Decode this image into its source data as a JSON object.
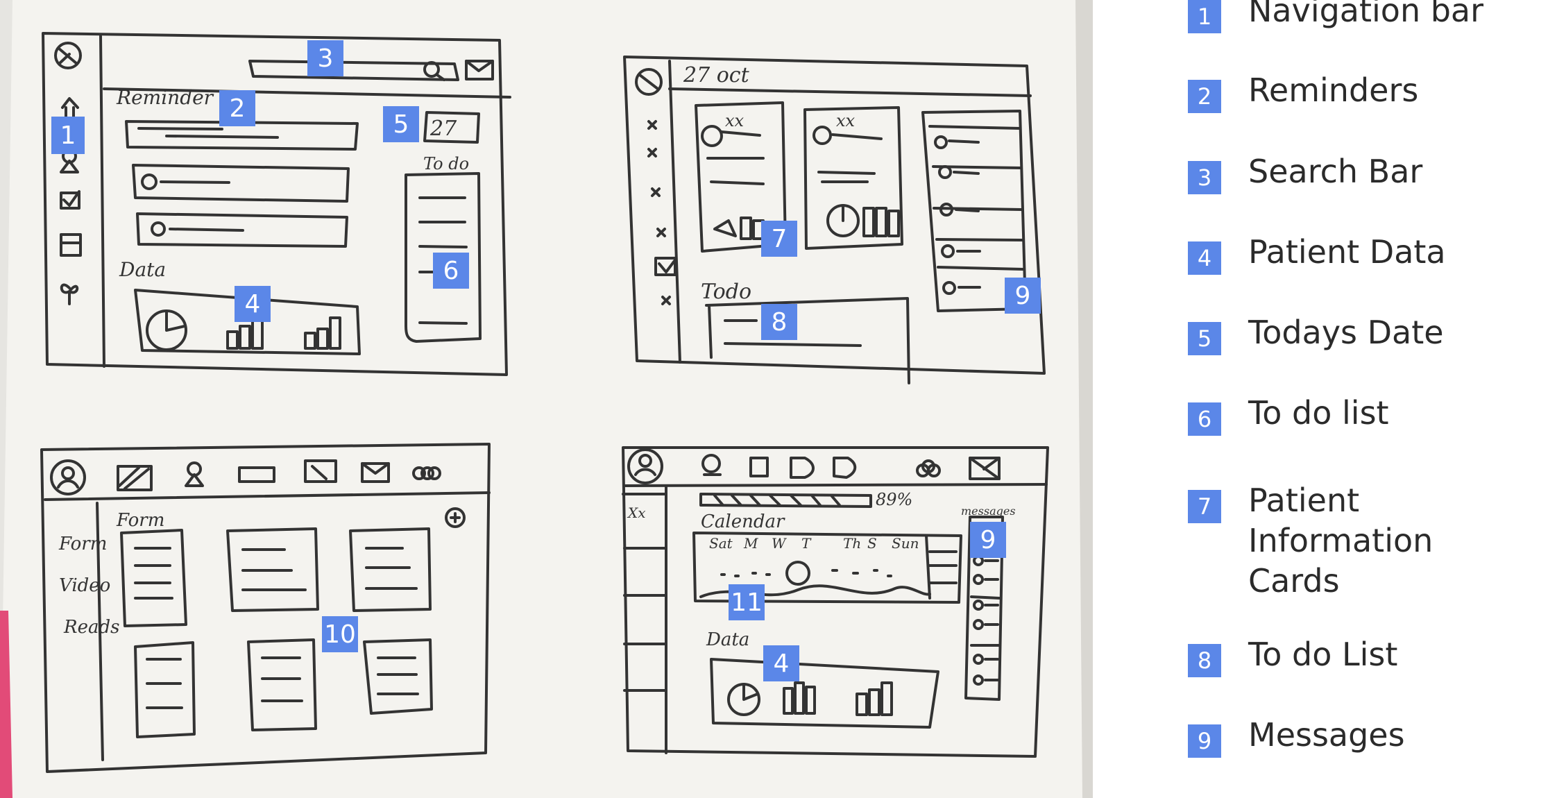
{
  "sketches": {
    "dashboard": {
      "reminder_label": "Reminder",
      "todo_label": "To do",
      "data_label": "Data",
      "date_label": "27"
    },
    "patients": {
      "date_label": "27 oct",
      "card_names": [
        "xx",
        "xx"
      ],
      "todo_label": "Todo"
    },
    "library": {
      "sidebar_items": [
        "Form",
        "Video",
        "Reads"
      ],
      "section_title": "Form",
      "add_icon": "plus-circle-icon"
    },
    "calendar": {
      "progress_label": "89%",
      "calendar_label": "Calendar",
      "days": [
        "Sat",
        "M",
        "W",
        "T",
        "Th",
        "S",
        "Sun"
      ],
      "data_label": "Data",
      "messages_label": "messages",
      "sidebar_item": "Xx"
    }
  },
  "badges": [
    "1",
    "2",
    "3",
    "4",
    "5",
    "6",
    "7",
    "8",
    "9",
    "10",
    "11",
    "4",
    "9"
  ],
  "legend": [
    {
      "num": "1",
      "label": "Navigation bar"
    },
    {
      "num": "2",
      "label": "Reminders"
    },
    {
      "num": "3",
      "label": "Search Bar"
    },
    {
      "num": "4",
      "label": "Patient Data"
    },
    {
      "num": "5",
      "label": "Todays Date"
    },
    {
      "num": "6",
      "label": "To do list"
    },
    {
      "num": "7",
      "label": "Patient\nInformation\nCards"
    },
    {
      "num": "8",
      "label": "To do List"
    },
    {
      "num": "9",
      "label": "Messages"
    }
  ],
  "colors": {
    "badge": "#5b87e8",
    "paper": "#f3f2ee",
    "pencil": "#333333",
    "background": "#e6e5e1"
  }
}
